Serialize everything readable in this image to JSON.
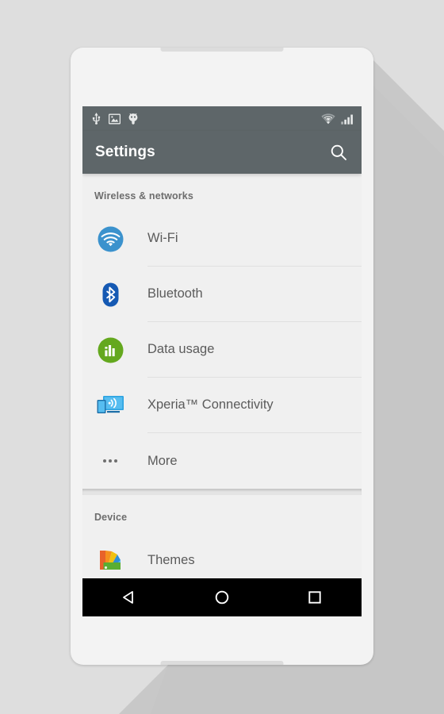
{
  "device": {
    "frame_color": "#f3f3f3",
    "background_color": "#dedede"
  },
  "status_bar": {
    "background_color": "#5e6669",
    "left_icons": [
      {
        "name": "usb-icon",
        "label": "USB connected"
      },
      {
        "name": "screenshot-icon",
        "label": "Screenshot captured"
      },
      {
        "name": "usb-debugging-icon",
        "label": "USB debugging connected"
      }
    ],
    "right_icons": [
      {
        "name": "wifi-signal-icon",
        "label": "Wi-Fi signal"
      },
      {
        "name": "cellular-signal-icon",
        "label": "Mobile signal"
      }
    ]
  },
  "app_bar": {
    "title": "Settings",
    "background_color": "#5e6669",
    "search_label": "Search"
  },
  "groups": [
    {
      "header": "Wireless & networks",
      "items": [
        {
          "label": "Wi-Fi",
          "icon": "wifi-icon",
          "icon_color": "#3b92cd"
        },
        {
          "label": "Bluetooth",
          "icon": "bluetooth-icon",
          "icon_color": "#1559b3"
        },
        {
          "label": "Data usage",
          "icon": "data-usage-icon",
          "icon_color": "#64a81e"
        },
        {
          "label": "Xperia™ Connectivity",
          "icon": "xperia-connectivity-icon",
          "icon_color": "#2ba2e0"
        },
        {
          "label": "More",
          "icon": "more-dots-icon",
          "icon_color": "#6f6f6f"
        }
      ]
    },
    {
      "header": "Device",
      "items": [
        {
          "label": "Themes",
          "icon": "themes-icon",
          "icon_color": "#e8622a"
        }
      ]
    }
  ],
  "nav_bar": {
    "background_color": "#000000",
    "buttons": [
      {
        "name": "back-button",
        "label": "Back"
      },
      {
        "name": "home-button",
        "label": "Home"
      },
      {
        "name": "recents-button",
        "label": "Recent apps"
      }
    ]
  }
}
